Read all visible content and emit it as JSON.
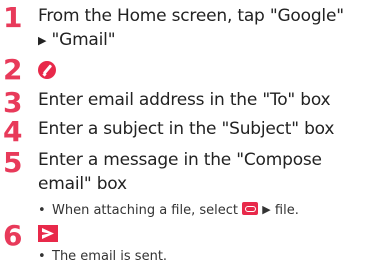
{
  "steps": [
    {
      "num": "1",
      "text_line1": "From the Home screen, tap \"Google\"",
      "text_line2": "\"Gmail\""
    },
    {
      "num": "2",
      "icon": "compose-pencil-icon"
    },
    {
      "num": "3",
      "text": "Enter email address in the \"To\" box"
    },
    {
      "num": "4",
      "text": "Enter a subject in the \"Subject\" box"
    },
    {
      "num": "5",
      "text_line1": "Enter a message in the \"Compose",
      "text_line2": "email\" box",
      "note_prefix": "When attaching a file, select",
      "note_suffix": "file."
    },
    {
      "num": "6",
      "icon": "send-icon",
      "note": "The email is sent."
    }
  ],
  "symbols": {
    "arrow": "▶",
    "bullet": "•"
  },
  "colors": {
    "accent": "#e8294a"
  }
}
